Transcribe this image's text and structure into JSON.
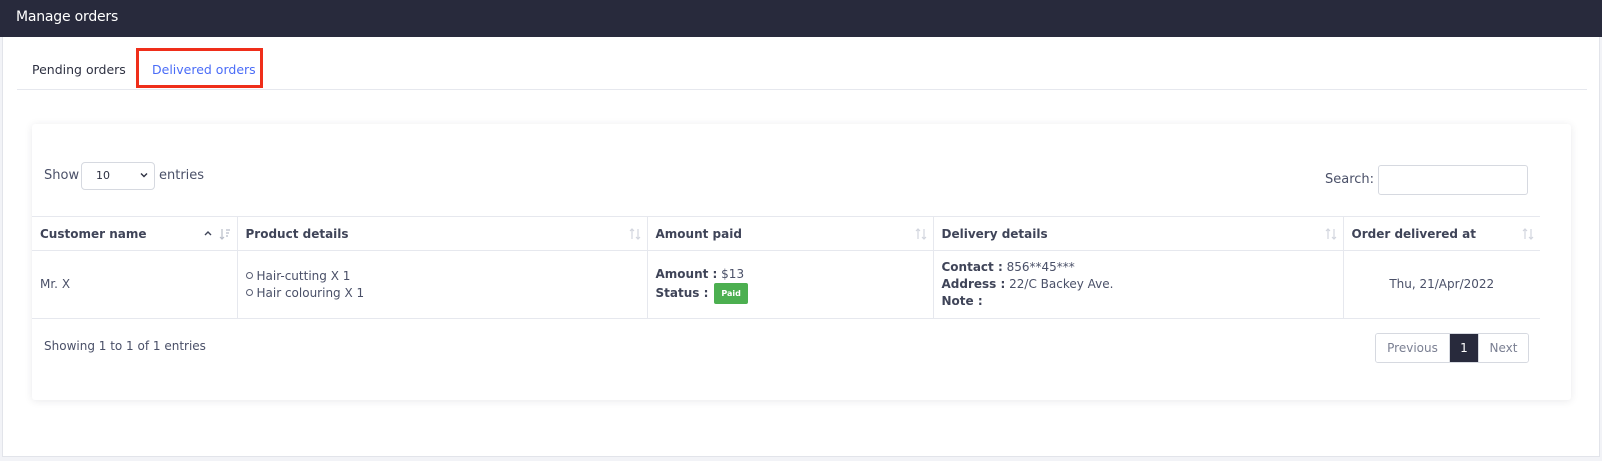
{
  "header": {
    "title": "Manage orders"
  },
  "tabs": [
    {
      "label": "Pending orders"
    },
    {
      "label": "Delivered orders"
    }
  ],
  "highlight_color": "#ef2e1a",
  "length": {
    "show_label": "Show",
    "selected": "10",
    "entries_label": "entries"
  },
  "search": {
    "label": "Search:",
    "value": ""
  },
  "table": {
    "columns": [
      "Customer name",
      "Product details",
      "Amount paid",
      "Delivery details",
      "Order delivered at"
    ],
    "rows": [
      {
        "customer": "Mr. X",
        "products": [
          "Hair-cutting X 1",
          "Hair colouring X 1"
        ],
        "amount_label": "Amount :",
        "amount": "$13",
        "status_label": "Status :",
        "status": "Paid",
        "contact_label": "Contact :",
        "contact": "856**45***",
        "address_label": "Address :",
        "address": "22/C Backey Ave.",
        "note_label": "Note :",
        "note": "",
        "delivered_at": "Thu, 21/Apr/2022"
      }
    ]
  },
  "info": "Showing 1 to 1 of 1 entries",
  "pagination": {
    "previous": "Previous",
    "current": "1",
    "next": "Next"
  },
  "icons": {
    "sort_asc": "chevron-up-icon",
    "sort": "sort-icon",
    "select_chevron": "chevron-down-icon",
    "bullet": "circle-bullet-icon"
  },
  "colors": {
    "header_bg": "#282a3c",
    "tab_active": "#4a6cf7",
    "paid": "#4caf50"
  }
}
